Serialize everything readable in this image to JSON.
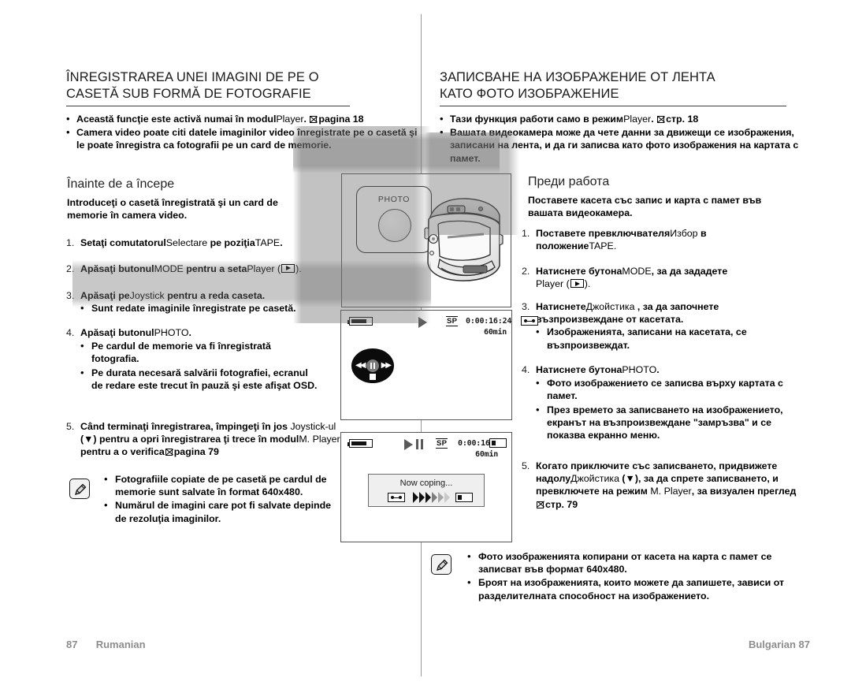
{
  "page": {
    "left_footer_number": "87",
    "left_footer_language": "Rumanian",
    "right_footer": "Bulgarian 87"
  },
  "left_column": {
    "language": "Romanian",
    "title_line1": "ÎNREGISTRAREA UNEI IMAGINI DE PE O",
    "title_line2": "CASETĂ SUB FORMĂ DE FOTOGRAFIE",
    "intro_bullets": [
      {
        "pre_bold": "Această funcţie este activă numai în modul",
        "mid_light": "Player",
        "post_bold": ". ",
        "ref": "pagina 18"
      },
      {
        "line1": "Camera video poate citi datele imaginilor video înregistrate pe o",
        "line2": "casetă şi le poate înregistra ca fotografii pe un card de memorie."
      }
    ],
    "before_heading": "Înainte de a începe",
    "before_text_line1": "Introduceţi o casetă înregistrată şi un card de",
    "before_text_line2": "memorie în camera video.",
    "steps": [
      {
        "num": "1.",
        "bold1": "Setaţi comutatorul",
        "light1": "Selectare",
        "bold2": " pe poziţia",
        "light2": "TAPE",
        "bold3": "."
      },
      {
        "num": "2.",
        "bold1": "Apăsaţi butonul",
        "light1": "MODE",
        "bold2": " pentru a seta",
        "light2": "Player",
        "bold3": " (",
        "glyph": "play-icon",
        "bold4": ")."
      },
      {
        "num": "3.",
        "bold1": "Apăsaţi pe",
        "light1": "Joystick",
        "bold2": " pentru a reda caseta.",
        "sub": [
          "Sunt redate imaginile înregistrate pe casetă."
        ]
      },
      {
        "num": "4.",
        "bold1": "Apăsaţi butonul",
        "light1": "PHOTO",
        "bold2": ".",
        "sub": [
          "Pe cardul de memorie va fi înregistrată fotografia.",
          "Pe durata necesară salvării fotografiei, ecranul de redare este trecut în pauză şi este afişat OSD."
        ]
      },
      {
        "num": "5.",
        "line1_bold": "Când terminaţi înregistrarea, împingeţi în jos",
        "line2_light": "Joystick-ul",
        "line2_bold": " (▼) pentru a opri înregistrarea ţi trece",
        "line3_bold_a": "în modul",
        "line3_light": "M. Player",
        "line3_bold_b": " pentru a o verifica",
        "line3_ref": "pagina 79"
      }
    ],
    "note_bullets": [
      "Fotografiile copiate de pe casetă pe cardul de memorie sunt salvate în format 640x480.",
      "Numărul de imagini care pot fi salvate depinde de rezoluţia imaginilor."
    ]
  },
  "right_column": {
    "language": "Bulgarian",
    "title_line1": "ЗАПИСВАНЕ НА ИЗОБРАЖЕНИЕ ОТ ЛЕНТА",
    "title_line2": "КАТО ФОТО ИЗОБРАЖЕНИЕ",
    "intro_bullets": [
      {
        "pre_bold": "Тази функция работи само в режим",
        "mid_light": "Player",
        "post_bold": ". ",
        "ref": "стр. 18"
      },
      {
        "line1": "Вашата видеокамера може да чете данни за движещи се",
        "line2": "изображения, записани на лента, и да ги записва като фото",
        "line3": "изображения на картата с памет."
      }
    ],
    "before_heading": "Преди работа",
    "before_text_line1": "Поставете касета със запис и карта с памет във",
    "before_text_line2": "вашата видеокамера.",
    "steps": [
      {
        "num": "1.",
        "bold1": "Поставете превключвателя",
        "light1": "Избор",
        "bold2": " в",
        "line2_bold": "положение",
        "line2_light": "TAPE",
        "line2_bold2": "."
      },
      {
        "num": "2.",
        "bold1": "Натиснете бутона",
        "light1": "MODE",
        "bold2": ", за да зададете",
        "line2_light": "Player",
        "line2_glyph": "play-icon"
      },
      {
        "num": "3.",
        "bold1": "Натиснете",
        "light1": "Джойстика",
        "bold2": " , за да започнете",
        "line2_bold": "възпроизвеждане от касетата.",
        "sub": [
          "Изображенията, записани на касетата, се възпроизвеждат."
        ]
      },
      {
        "num": "4.",
        "bold1": "Натиснете бутона",
        "light1": "PHOTO",
        "bold2": ".",
        "sub": [
          "Фото изображението се записва върху картата с памет.",
          "През времето за записването на изображението, екранът на възпроизвеждане \"замръзва\" и се показва екранно меню."
        ]
      },
      {
        "num": "5.",
        "line1_bold": "Когато приключите със записването,",
        "line2_bold_a": "придвижете надолу",
        "line2_light": "Джойстика",
        "line2_bold_b": " (▼), за да",
        "line3_bold": "спрете записването, и превключете на режим",
        "line4_light": "M. Player",
        "line4_bold": ", за визуален преглед",
        "line4_ref": "стр. 79"
      }
    ],
    "note_bullets": [
      "Фото изображенията копирани от касета на карта с памет се записват във формат 640x480.",
      "Броят на изображенията, които можете да запишете, зависи от разделителната способност на изображението."
    ]
  },
  "illustrations": {
    "camera_panel": {
      "callout_label": "PHOTO",
      "device": "camcorder-illustration"
    },
    "lcd_playback": {
      "battery": "battery-icon",
      "play_state": "play-icon",
      "quality": "SP",
      "timecode": "0:00:16:24",
      "media": "tape-icon",
      "remaining": "60min",
      "overlay": "joystick-control-overlay",
      "overlay_buttons": [
        "rewind",
        "pause",
        "forward",
        "stop"
      ]
    },
    "lcd_copying": {
      "battery": "battery-icon",
      "play_state": "play-pause-icon",
      "quality": "SP",
      "timecode": "0:00:16:24",
      "media": "card-icon",
      "remaining": "60min",
      "dialog_text": "Now coping...",
      "dialog_from": "tape-icon",
      "dialog_arrows": "chevrons-icon",
      "dialog_to": "card-icon"
    }
  }
}
